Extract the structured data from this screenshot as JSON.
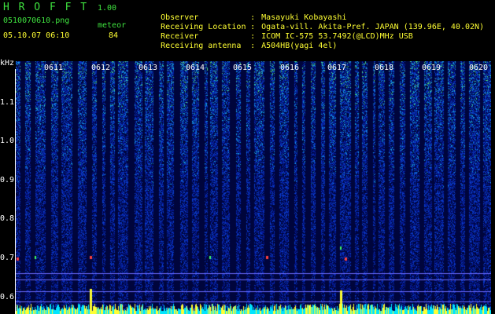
{
  "app": {
    "title": "H R O F F T",
    "version": "1.00"
  },
  "file": {
    "name": "0510070610.png",
    "datetime": "05.10.07 06:10"
  },
  "meteor": {
    "label": "meteor",
    "count": "84"
  },
  "header": {
    "rows": [
      {
        "label": "Observer",
        "value": "Masayuki Kobayashi"
      },
      {
        "label": "Receiving Location",
        "value": "Ogata-vill. Akita-Pref. JAPAN (139.96E, 40.02N)"
      },
      {
        "label": "Receiver",
        "value": "ICOM IC-575 53.7492(@LCD)MHz USB"
      },
      {
        "label": "Receiving antenna",
        "value": "A504HB(yagi 4el)"
      }
    ],
    "separator": ":"
  },
  "axis": {
    "unit": "kHz",
    "y_labels": [
      "1.1",
      "1.0",
      "0.9",
      "0.8",
      "0.7",
      "0.6"
    ],
    "time_ticks": [
      "0611",
      "0612",
      "0613",
      "0614",
      "0615",
      "0616",
      "0617",
      "0618",
      "0619",
      "0620"
    ]
  },
  "colors": {
    "background": "#000000",
    "label_green": "#3fe23f",
    "label_yellow": "#ffff33",
    "tick_white": "#ffffff"
  }
}
